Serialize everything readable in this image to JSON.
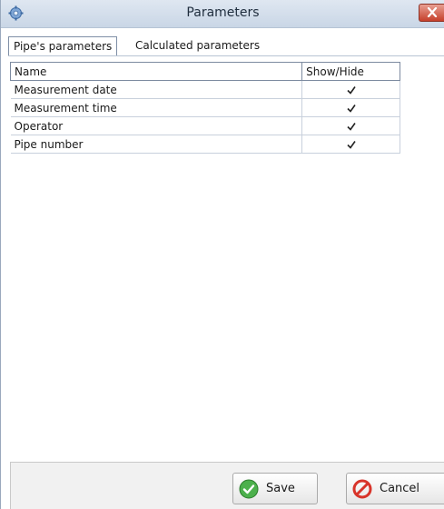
{
  "window": {
    "title": "Parameters"
  },
  "tabs": [
    {
      "label": "Pipe's parameters",
      "active": true
    },
    {
      "label": "Calculated parameters",
      "active": false
    }
  ],
  "grid": {
    "columns": [
      "Name",
      "Show/Hide"
    ],
    "rows": [
      {
        "name": "Measurement date",
        "show": true
      },
      {
        "name": "Measurement time",
        "show": true
      },
      {
        "name": "Operator",
        "show": true
      },
      {
        "name": "Pipe number",
        "show": true
      }
    ]
  },
  "buttons": {
    "save_label": "Save",
    "cancel_label": "Cancel"
  },
  "icons": {
    "app": "gear-icon",
    "close": "close-icon",
    "save": "checkmark-icon",
    "cancel": "cancel-icon"
  },
  "colors": {
    "titlebar": "#c9d6e6",
    "close_button": "#c6402b",
    "save_icon": "#3aa13a",
    "cancel_icon": "#d8342a"
  }
}
